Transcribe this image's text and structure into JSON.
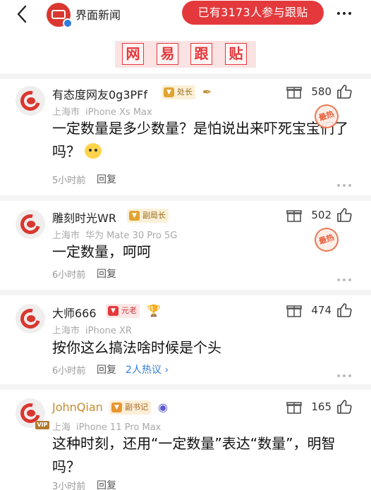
{
  "header": {
    "source_name": "界面新闻",
    "join_text": "已有3173人参与跟贴",
    "back_icon": "chevron-left-icon",
    "more_icon": "more-dots-icon"
  },
  "banner": {
    "chars": [
      "网",
      "易",
      "跟",
      "贴"
    ]
  },
  "comments": [
    {
      "username": "有态度网友0g3PFf",
      "badge": "处长",
      "location": "上海市",
      "device": "iPhone Xs Max",
      "text": "一定数量是多少数量？是怕说出来吓死宝宝们了吗？",
      "time": "5小时前",
      "reply": "回复",
      "votes": "580",
      "hot_label": "最热"
    },
    {
      "username": "雕刻时光WR",
      "badge": "副局长",
      "location": "上海市",
      "device": "华为 Mate 30 Pro 5G",
      "text": "一定数量，呵呵",
      "time": "6小时前",
      "reply": "回复",
      "votes": "502",
      "hot_label": "最热"
    },
    {
      "username": "大师666",
      "badge": "元老",
      "location": "上海市",
      "device": "iPhone XR",
      "text": "按你这么搞法啥时候是个头",
      "time": "6小时前",
      "reply": "回复",
      "votes": "474",
      "hot_discussion": "2人热议 ›"
    },
    {
      "username": "JohnQian",
      "badge": "副书记",
      "vip": "VIP",
      "location": "上海",
      "device": "iPhone 11 Pro Max",
      "text": "这种时刻，还用“一定数量”表达“数量”，明智吗？",
      "time": "3小时前",
      "reply": "回复",
      "votes": "165"
    }
  ],
  "colors": {
    "accent": "#e4393c",
    "link": "#2f7de1",
    "gold_name": "#c68a2e"
  }
}
